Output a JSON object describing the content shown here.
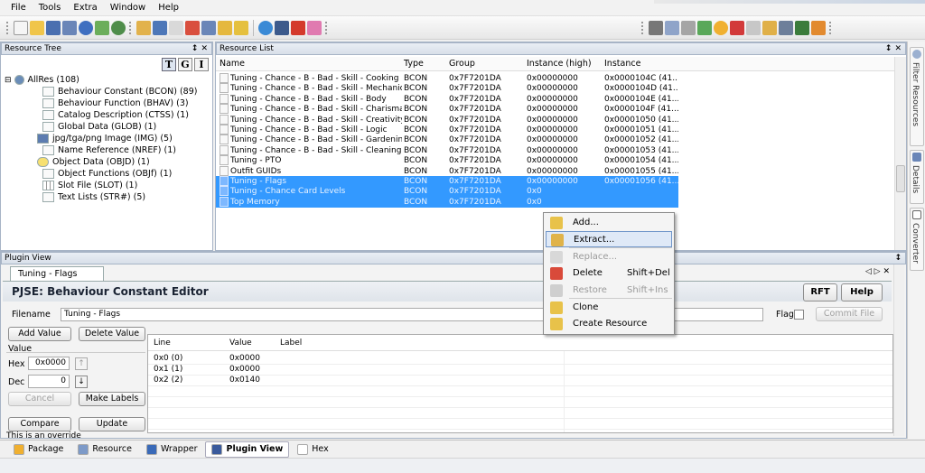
{
  "menu": [
    "File",
    "Tools",
    "Extra",
    "Window",
    "Help"
  ],
  "colors": {
    "selection": "#3399ff",
    "panel_border": "#a7b4c6"
  },
  "resource_tree": {
    "title": "Resource Tree",
    "controls": "↕ ✕",
    "tgi_buttons": [
      "T",
      "G",
      "I"
    ],
    "nodes": [
      {
        "label": "AllRes (108)",
        "icon": "globe-icon"
      },
      {
        "label": "Behaviour Constant (BCON) (89)",
        "icon": "file-icon"
      },
      {
        "label": "Behaviour Function (BHAV) (3)",
        "icon": "file-icon"
      },
      {
        "label": "Catalog Description (CTSS) (1)",
        "icon": "file-icon"
      },
      {
        "label": "Global Data (GLOB) (1)",
        "icon": "file-icon"
      },
      {
        "label": "jpg/tga/png Image (IMG) (5)",
        "icon": "image-icon"
      },
      {
        "label": "Name Reference (NREF) (1)",
        "icon": "file-icon"
      },
      {
        "label": "Object Data (OBJD) (1)",
        "icon": "object-icon"
      },
      {
        "label": "Object Functions (OBJf) (1)",
        "icon": "file-icon"
      },
      {
        "label": "Slot File (SLOT) (1)",
        "icon": "grid-icon"
      },
      {
        "label": "Text Lists (STR#) (5)",
        "icon": "file-icon"
      }
    ]
  },
  "resource_list": {
    "title": "Resource List",
    "controls": "↕ ✕",
    "columns": [
      "Name",
      "Type",
      "Group",
      "Instance (high)",
      "Instance"
    ],
    "rows": [
      {
        "name": "Tuning - Chance - B - Bad - Skill - Cooking",
        "type": "BCON",
        "group": "0x7F7201DA",
        "ihigh": "0x00000000",
        "inst": "0x0000104C (41...",
        "sel": false
      },
      {
        "name": "Tuning - Chance - B - Bad - Skill - Mechanical",
        "type": "BCON",
        "group": "0x7F7201DA",
        "ihigh": "0x00000000",
        "inst": "0x0000104D (41...",
        "sel": false
      },
      {
        "name": "Tuning - Chance - B - Bad - Skill - Body",
        "type": "BCON",
        "group": "0x7F7201DA",
        "ihigh": "0x00000000",
        "inst": "0x0000104E (41...",
        "sel": false
      },
      {
        "name": "Tuning - Chance - B - Bad - Skill - Charisma",
        "type": "BCON",
        "group": "0x7F7201DA",
        "ihigh": "0x00000000",
        "inst": "0x0000104F (41...",
        "sel": false
      },
      {
        "name": "Tuning - Chance - B - Bad - Skill - Creativity",
        "type": "BCON",
        "group": "0x7F7201DA",
        "ihigh": "0x00000000",
        "inst": "0x00001050 (41...",
        "sel": false
      },
      {
        "name": "Tuning - Chance - B - Bad - Skill - Logic",
        "type": "BCON",
        "group": "0x7F7201DA",
        "ihigh": "0x00000000",
        "inst": "0x00001051 (41...",
        "sel": false
      },
      {
        "name": "Tuning - Chance - B - Bad - Skill - Gardening",
        "type": "BCON",
        "group": "0x7F7201DA",
        "ihigh": "0x00000000",
        "inst": "0x00001052 (41...",
        "sel": false
      },
      {
        "name": "Tuning - Chance - B - Bad - Skill - Cleaning",
        "type": "BCON",
        "group": "0x7F7201DA",
        "ihigh": "0x00000000",
        "inst": "0x00001053 (41...",
        "sel": false
      },
      {
        "name": "Tuning - PTO",
        "type": "BCON",
        "group": "0x7F7201DA",
        "ihigh": "0x00000000",
        "inst": "0x00001054 (41...",
        "sel": false
      },
      {
        "name": "Outfit GUIDs",
        "type": "BCON",
        "group": "0x7F7201DA",
        "ihigh": "0x00000000",
        "inst": "0x00001055 (41...",
        "sel": false
      },
      {
        "name": "Tuning - Flags",
        "type": "BCON",
        "group": "0x7F7201DA",
        "ihigh": "0x00000000",
        "inst": "0x00001056 (41...",
        "sel": true
      },
      {
        "name": "Tuning - Chance Card Levels",
        "type": "BCON",
        "group": "0x7F7201DA",
        "ihigh": "0x0",
        "inst": "",
        "sel": true
      },
      {
        "name": "Top Memory",
        "type": "BCON",
        "group": "0x7F7201DA",
        "ihigh": "0x0",
        "inst": "",
        "sel": true
      }
    ]
  },
  "side_tabs": [
    "Filter Resources",
    "Details",
    "Converter"
  ],
  "plugin_view": {
    "title": "Plugin View",
    "pin": "↕",
    "tab_label": "Tuning - Flags",
    "tab_controls": "◁ ▷ ✕",
    "editor_title": "PJSE: Behaviour Constant Editor",
    "rft_label": "RFT",
    "help_label": "Help",
    "filename_label": "Filename",
    "filename_value": "Tuning - Flags",
    "flag_label": "Flag",
    "commit_label": "Commit File",
    "add_value": "Add Value",
    "delete_value": "Delete Value",
    "value_group": "Value",
    "hex_label": "Hex",
    "hex_value": "0x0000",
    "dec_label": "Dec",
    "dec_value": "0",
    "cancel_label": "Cancel",
    "make_labels": "Make Labels",
    "compare_label": "Compare",
    "update_label": "Update",
    "override_text": "This is an override",
    "grid_columns": [
      "Line",
      "Value",
      "Label"
    ],
    "grid_rows": [
      {
        "line": "0x0 (0)",
        "value": "0x0000",
        "label": ""
      },
      {
        "line": "0x1 (1)",
        "value": "0x0000",
        "label": ""
      },
      {
        "line": "0x2 (2)",
        "value": "0x0140",
        "label": ""
      }
    ]
  },
  "bottom_tabs": [
    {
      "label": "Package",
      "icon": "package-icon",
      "active": false
    },
    {
      "label": "Resource",
      "icon": "resource-icon",
      "active": false
    },
    {
      "label": "Wrapper",
      "icon": "wrapper-icon",
      "active": false
    },
    {
      "label": "Plugin View",
      "icon": "plugin-icon",
      "active": true
    },
    {
      "label": "Hex",
      "icon": "hex-icon",
      "active": false
    }
  ],
  "context_menu": [
    {
      "label": "Add...",
      "shortcut": "",
      "state": "normal",
      "icon": "add-icon"
    },
    {
      "label": "Extract...",
      "shortcut": "",
      "state": "highlight",
      "icon": "extract-icon"
    },
    {
      "label": "Replace...",
      "shortcut": "",
      "state": "disabled",
      "icon": "replace-icon"
    },
    {
      "label": "Delete",
      "shortcut": "Shift+Del",
      "state": "normal",
      "icon": "delete-icon"
    },
    {
      "label": "Restore",
      "shortcut": "Shift+Ins",
      "state": "disabled",
      "icon": "restore-icon"
    },
    {
      "label": "Clone",
      "shortcut": "",
      "state": "normal",
      "icon": "clone-icon"
    },
    {
      "label": "Create Resource",
      "shortcut": "",
      "state": "normal",
      "icon": "create-resource-icon"
    }
  ]
}
